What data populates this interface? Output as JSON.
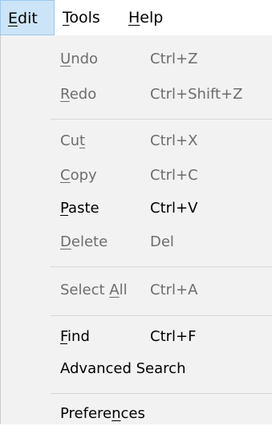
{
  "menubar": {
    "edit": {
      "pre": "",
      "acc": "E",
      "post": "dit"
    },
    "tools": {
      "pre": "",
      "acc": "T",
      "post": "ools"
    },
    "help": {
      "pre": "",
      "acc": "H",
      "post": "elp"
    }
  },
  "menu": {
    "undo": {
      "pre": "",
      "acc": "U",
      "post": "ndo",
      "shortcut": "Ctrl+Z",
      "enabled": false
    },
    "redo": {
      "pre": "",
      "acc": "R",
      "post": "edo",
      "shortcut": "Ctrl+Shift+Z",
      "enabled": false
    },
    "cut": {
      "pre": "Cu",
      "acc": "t",
      "post": "",
      "shortcut": "Ctrl+X",
      "enabled": false
    },
    "copy": {
      "pre": "",
      "acc": "C",
      "post": "opy",
      "shortcut": "Ctrl+C",
      "enabled": false
    },
    "paste": {
      "pre": "",
      "acc": "P",
      "post": "aste",
      "shortcut": "Ctrl+V",
      "enabled": true
    },
    "delete": {
      "pre": "",
      "acc": "D",
      "post": "elete",
      "shortcut": "Del",
      "enabled": false
    },
    "selectall": {
      "pre": "Select ",
      "acc": "A",
      "post": "ll",
      "shortcut": "Ctrl+A",
      "enabled": false
    },
    "find": {
      "pre": "",
      "acc": "F",
      "post": "ind",
      "shortcut": "Ctrl+F",
      "enabled": true
    },
    "advanced": {
      "pre": "Advanced Search",
      "acc": "",
      "post": "",
      "shortcut": "",
      "enabled": true
    },
    "prefs": {
      "pre": "Prefere",
      "acc": "n",
      "post": "ces",
      "shortcut": "",
      "enabled": true
    }
  }
}
